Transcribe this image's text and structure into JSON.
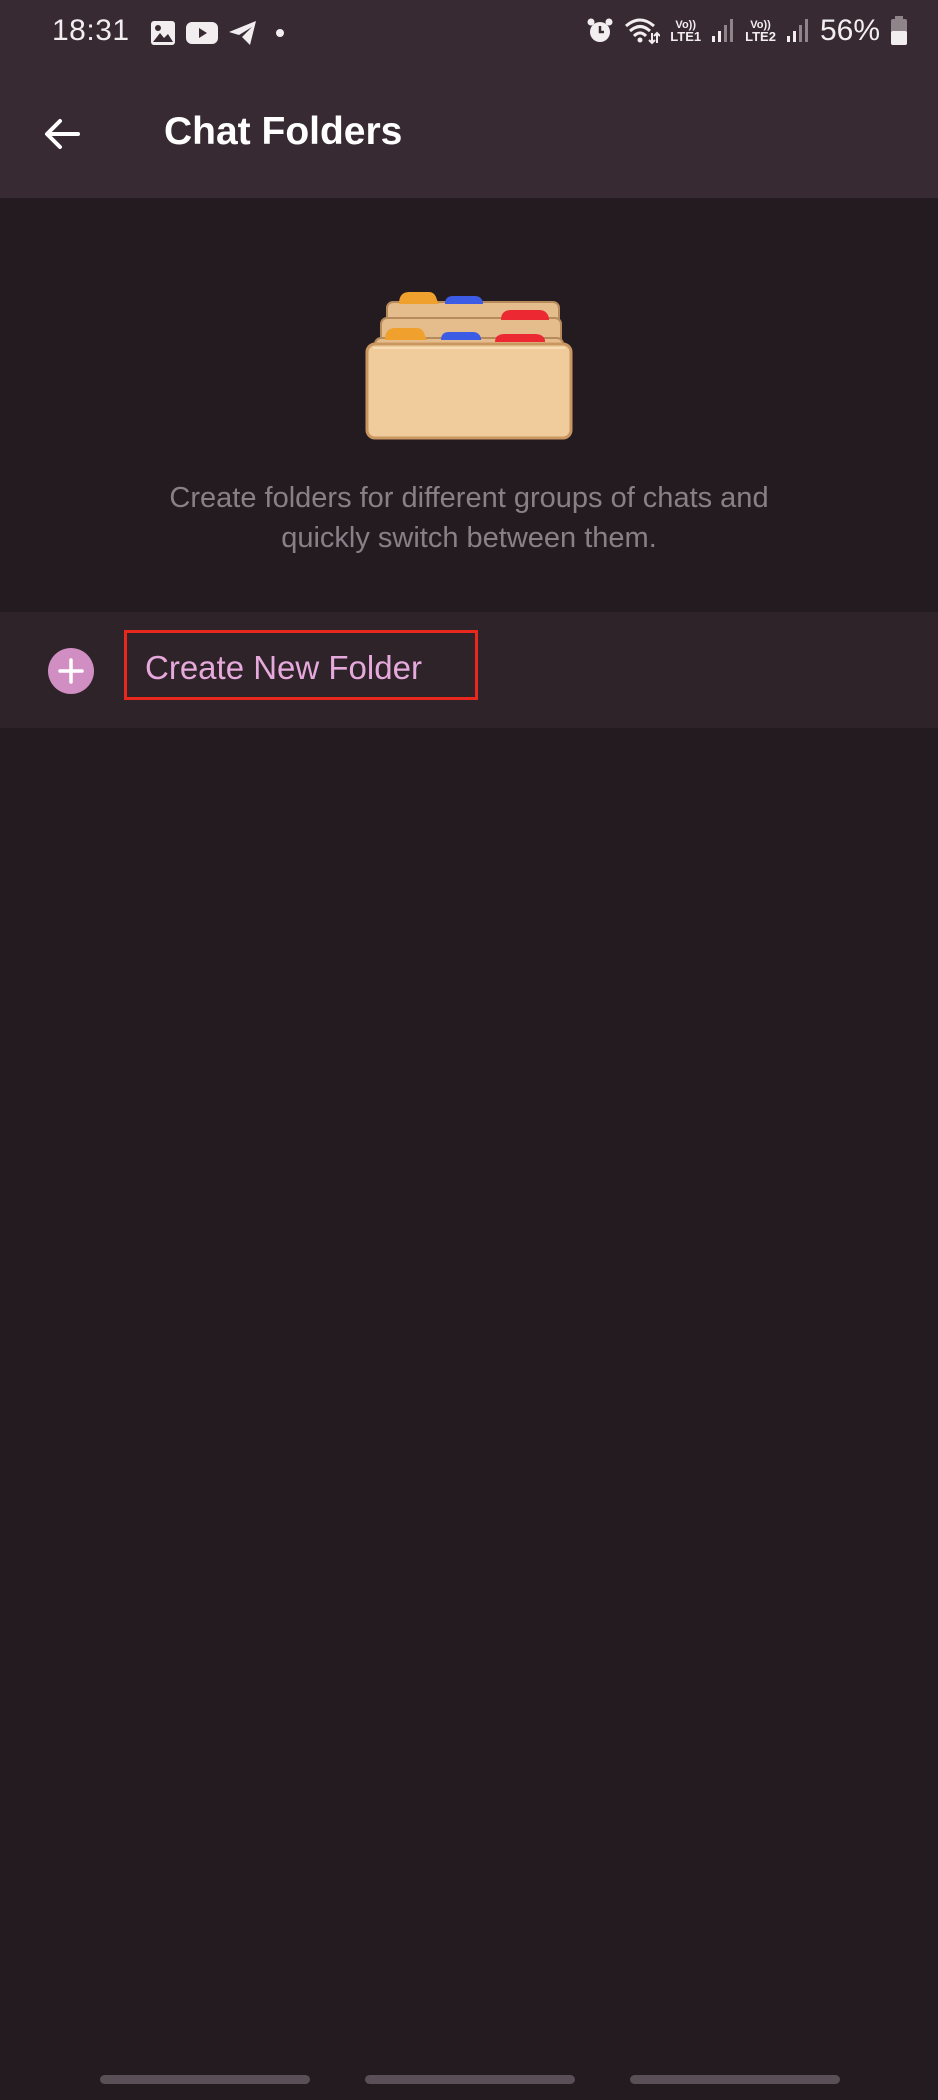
{
  "status_bar": {
    "time": "18:31",
    "left_icons": [
      "gallery-icon",
      "youtube-icon",
      "telegram-icon",
      "dot-icon"
    ],
    "right_icons": [
      "alarm-icon",
      "wifi-icon",
      "volte-lte1-icon",
      "signal-1-icon",
      "volte-lte2-icon",
      "signal-2-icon",
      "battery-icon"
    ],
    "volte_label": "Vo))",
    "lte1_label": "LTE1",
    "lte2_label": "LTE2",
    "battery_percent": "56%"
  },
  "app_bar": {
    "back_icon": "arrow-left-icon",
    "title": "Chat Folders"
  },
  "hero": {
    "illustration": "stacked-folders-icon",
    "tab_colors": [
      "#f0a02c",
      "#3c5ce6",
      "#ec2833"
    ],
    "description_line1": "Create folders for different groups of chats and",
    "description_line2": "quickly switch between them."
  },
  "actions": {
    "create_folder_icon": "plus-circle-icon",
    "create_folder_label": "Create New Folder",
    "accent_color": "#e6a9dc",
    "highlight_color": "#e8281c"
  },
  "nav_bar": {
    "handles": [
      "recents",
      "home",
      "back"
    ]
  }
}
